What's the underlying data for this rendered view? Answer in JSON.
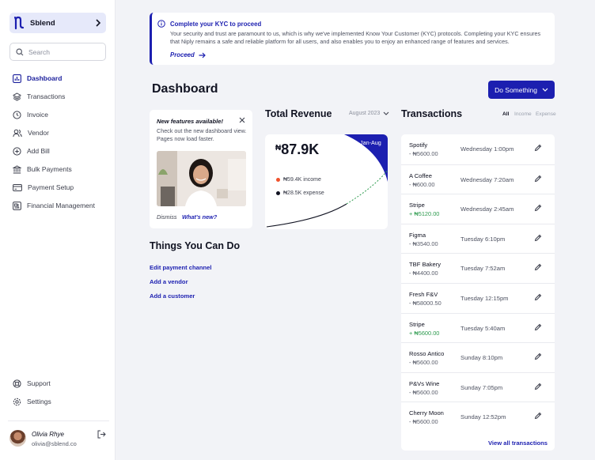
{
  "sidebar": {
    "brand": "Sblend",
    "search_placeholder": "Search",
    "nav": [
      {
        "label": "Dashboard",
        "icon": "chart-icon",
        "active": true
      },
      {
        "label": "Transactions",
        "icon": "layers-icon"
      },
      {
        "label": "Invoice",
        "icon": "clock-icon"
      },
      {
        "label": "Vendor",
        "icon": "users-icon"
      },
      {
        "label": "Add Bill",
        "icon": "plus-circle-icon"
      },
      {
        "label": "Bulk Payments",
        "icon": "bank-icon"
      },
      {
        "label": "Payment Setup",
        "icon": "card-icon"
      },
      {
        "label": "Financial Management",
        "icon": "wallet-icon"
      }
    ],
    "bottom": [
      {
        "label": "Support",
        "icon": "lifebuoy-icon"
      },
      {
        "label": "Settings",
        "icon": "gear-icon"
      }
    ],
    "user": {
      "name": "Olivia Rhye",
      "email": "olivia@sblend.co"
    }
  },
  "banner": {
    "title": "Complete your KYC to proceed",
    "body": "Your security and trust are paramount to us, which is why we've implemented Know Your Customer (KYC) protocols. Completing your KYC ensures that Niply remains a safe and reliable platform for all users, and also enables you to enjoy an enhanced range of features and services.",
    "link": "Proceed"
  },
  "page_title": "Dashboard",
  "action_button": "Do Something",
  "feature_card": {
    "title": "New features available!",
    "body": "Check out the new dashboard view. Pages now load faster.",
    "dismiss": "Dismiss",
    "whats_new": "What's new?"
  },
  "things": {
    "title": "Things You Can Do",
    "links": [
      "Edit payment channel",
      "Add a vendor",
      "Add a customer"
    ]
  },
  "revenue": {
    "title": "Total Revenue",
    "period": "August 2023",
    "currency": "₦",
    "amount": "87.9K",
    "range": "Jan-Aug",
    "income": "₦59.4K income",
    "expense": "₦28.5K expense",
    "colors": {
      "income": "#f0522c",
      "expense": "#111322",
      "accent": "#1c1fb0"
    }
  },
  "transactions": {
    "title": "Transactions",
    "filters": [
      "All",
      "Income",
      "Expense"
    ],
    "active_filter": "All",
    "rows": [
      {
        "name": "Spotify",
        "amount": "- ₦5600.00",
        "time": "Wednesday 1:00pm"
      },
      {
        "name": "A Coffee",
        "amount": "- ₦600.00",
        "time": "Wednesday 7:20am"
      },
      {
        "name": "Stripe",
        "amount": "+ ₦5120.00",
        "time": "Wednesday 2:45am",
        "income": true
      },
      {
        "name": "Figma",
        "amount": "- ₦3540.00",
        "time": "Tuesday 6:10pm"
      },
      {
        "name": "TBF Bakery",
        "amount": "- ₦4400.00",
        "time": "Tuesday 7:52am"
      },
      {
        "name": "Fresh F&V",
        "amount": "- ₦58000.50",
        "time": "Tuesday 12:15pm"
      },
      {
        "name": "Stripe",
        "amount": "+ ₦5600.00",
        "time": "Tuesday 5:40am",
        "income": true
      },
      {
        "name": "Rosso Antico",
        "amount": "- ₦5600.00",
        "time": "Sunday 8:10pm"
      },
      {
        "name": "P&Vs Wine",
        "amount": "- ₦5600.00",
        "time": "Sunday 7:05pm"
      },
      {
        "name": "Cherry Moon",
        "amount": "- ₦5600.00",
        "time": "Sunday 12:52pm"
      }
    ],
    "view_all": "View all transactions"
  }
}
